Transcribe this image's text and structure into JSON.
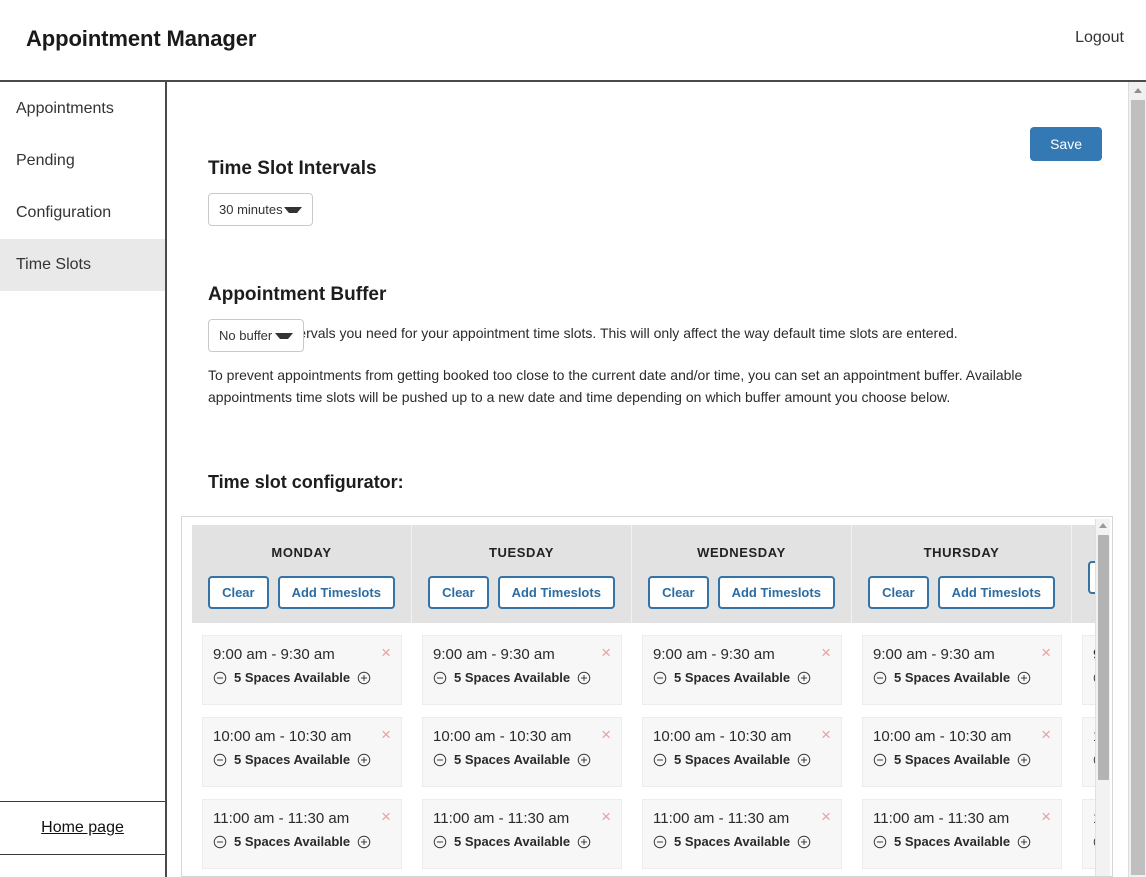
{
  "header": {
    "app_title": "Appointment Manager",
    "logout_label": "Logout"
  },
  "sidebar": {
    "items": [
      {
        "label": "Appointments",
        "active": false
      },
      {
        "label": "Pending",
        "active": false
      },
      {
        "label": "Configuration",
        "active": false
      },
      {
        "label": "Time Slots",
        "active": true
      }
    ],
    "home_link": "Home page"
  },
  "main": {
    "save_label": "Save",
    "intervals": {
      "title": "Time Slot Intervals",
      "selected": "30 minutes",
      "description": "Choose the intervals you need for your appointment time slots. This will only affect the way default time slots are entered."
    },
    "buffer": {
      "title": "Appointment Buffer",
      "selected": "No buffer",
      "description": "To prevent appointments from getting booked too close to the current date and/or time, you can set an appointment buffer. Available appointments time slots will be pushed up to a new date and time depending on which buffer amount you choose below."
    },
    "configurator": {
      "title": "Time slot configurator:",
      "clear_label": "Clear",
      "add_label": "Add Timeslots",
      "spaces_label": "5 Spaces Available",
      "decrement_icon": "minus-circle-icon",
      "increment_icon": "plus-circle-icon",
      "remove_icon": "close-icon",
      "accent_color": "#2b6ca3",
      "days": [
        {
          "name": "MONDAY"
        },
        {
          "name": "TUESDAY"
        },
        {
          "name": "WEDNESDAY"
        },
        {
          "name": "THURSDAY"
        },
        {
          "name": ""
        }
      ],
      "slots": [
        {
          "time": "9:00 am - 9:30 am",
          "spaces": "5 Spaces Available"
        },
        {
          "time": "10:00 am - 10:30 am",
          "spaces": "5 Spaces Available"
        },
        {
          "time": "11:00 am - 11:30 am",
          "spaces": "5 Spaces Available"
        }
      ]
    }
  }
}
